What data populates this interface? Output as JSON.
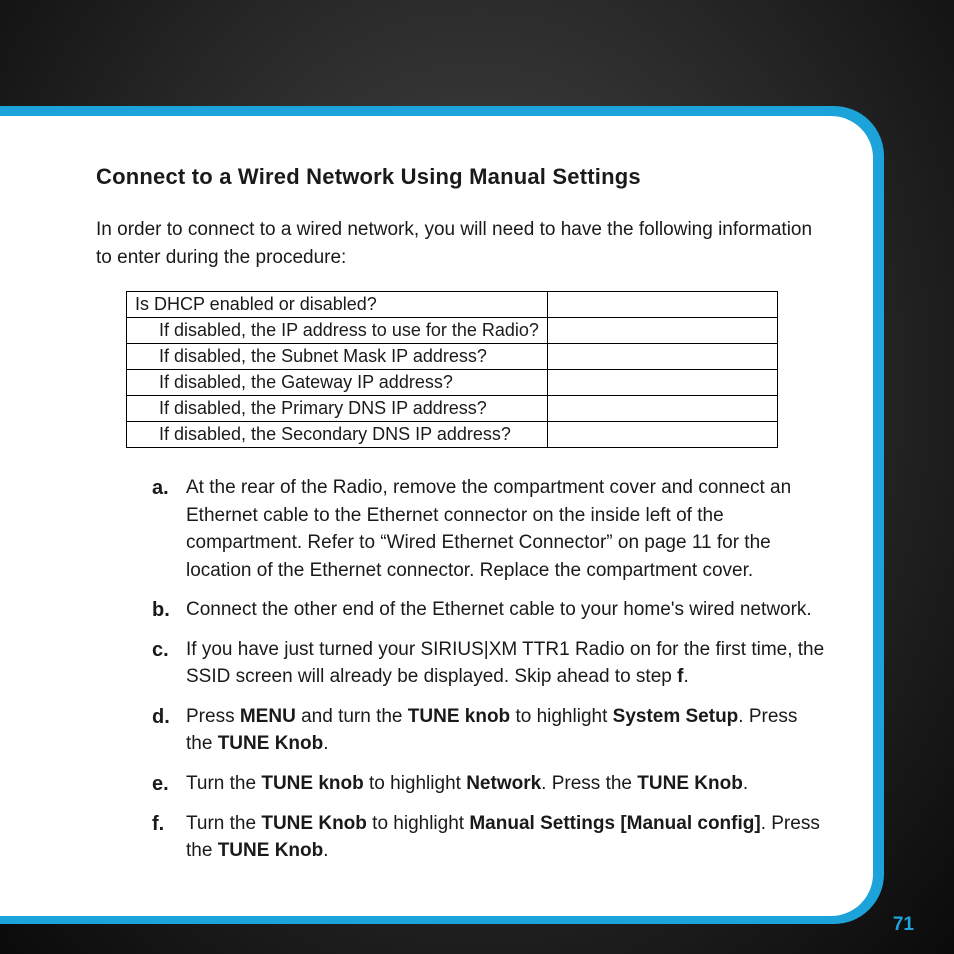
{
  "heading": "Connect to a Wired Network Using Manual Settings",
  "intro": "In order to connect to a wired network, you will need to have the following information to enter during the procedure:",
  "table": {
    "rows": [
      {
        "label": "Is DHCP enabled or disabled?",
        "indent": false
      },
      {
        "label": "If disabled, the IP address to use for the Radio?",
        "indent": true
      },
      {
        "label": "If disabled, the Subnet Mask IP address?",
        "indent": true
      },
      {
        "label": "If disabled, the Gateway IP address?",
        "indent": true
      },
      {
        "label": "If disabled, the Primary DNS IP address?",
        "indent": true
      },
      {
        "label": "If disabled, the Secondary DNS IP address?",
        "indent": true
      }
    ]
  },
  "steps": {
    "a": {
      "marker": "a.",
      "parts": [
        "At the rear of the Radio, remove the compartment cover and connect an Ethernet cable to the Ethernet connector on the inside left of the compartment. Refer to “Wired Ethernet Connector” on page 11 for the location of the Ethernet connector. Replace the compartment cover."
      ]
    },
    "b": {
      "marker": "b.",
      "parts": [
        "Connect the other end of the Ethernet cable to your home's wired network."
      ]
    },
    "c": {
      "marker": "c.",
      "parts": [
        "If you have just turned your SIRIUS|XM TTR1 Radio on for the first time, the SSID screen will already be displayed. Skip ahead to step ",
        "f",
        "."
      ]
    },
    "d": {
      "marker": "d.",
      "parts": [
        "Press ",
        "MENU",
        " and turn the ",
        "TUNE knob",
        " to highlight ",
        "System Setup",
        ". Press the ",
        "TUNE Knob",
        "."
      ]
    },
    "e": {
      "marker": "e.",
      "parts": [
        "Turn the ",
        "TUNE knob",
        " to highlight ",
        "Network",
        ". Press the ",
        "TUNE Knob",
        "."
      ]
    },
    "f": {
      "marker": "f.",
      "parts": [
        "Turn the ",
        "TUNE Knob",
        " to highlight ",
        "Manual Settings [Manual config]",
        ". Press the ",
        "TUNE Knob",
        "."
      ]
    }
  },
  "page_number": "71"
}
